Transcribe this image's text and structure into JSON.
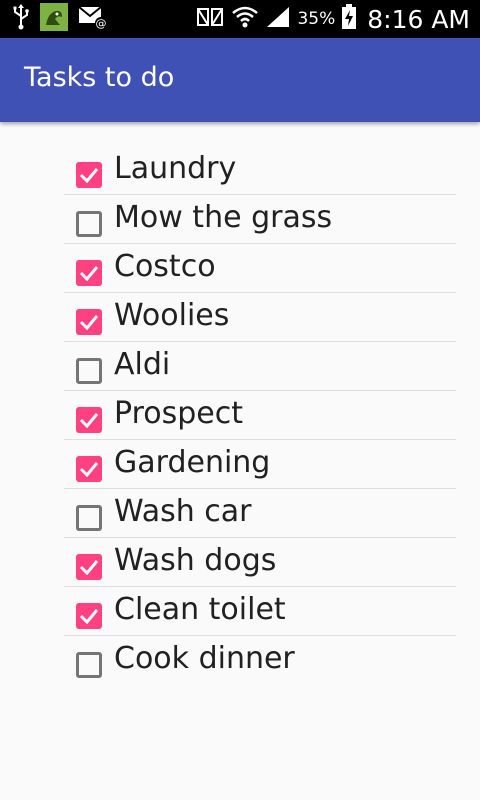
{
  "status_bar": {
    "icons_left": [
      "usb-icon",
      "android-notification-icon",
      "email-icon"
    ],
    "icons_right": [
      "nfc-icon",
      "wifi-icon",
      "signal-icon"
    ],
    "battery": "35%",
    "time": "8:16 AM"
  },
  "app_bar": {
    "title": "Tasks to do",
    "color": "#3f51b5"
  },
  "colors": {
    "accent": "#ff4081",
    "unchecked_border": "#757575"
  },
  "tasks": [
    {
      "label": "Laundry",
      "checked": true
    },
    {
      "label": "Mow the grass",
      "checked": false
    },
    {
      "label": "Costco",
      "checked": true
    },
    {
      "label": "Woolies",
      "checked": true
    },
    {
      "label": "Aldi",
      "checked": false
    },
    {
      "label": "Prospect",
      "checked": true
    },
    {
      "label": "Gardening",
      "checked": true
    },
    {
      "label": "Wash car",
      "checked": false
    },
    {
      "label": "Wash dogs",
      "checked": true
    },
    {
      "label": "Clean toilet",
      "checked": true
    },
    {
      "label": "Cook dinner",
      "checked": false
    }
  ]
}
